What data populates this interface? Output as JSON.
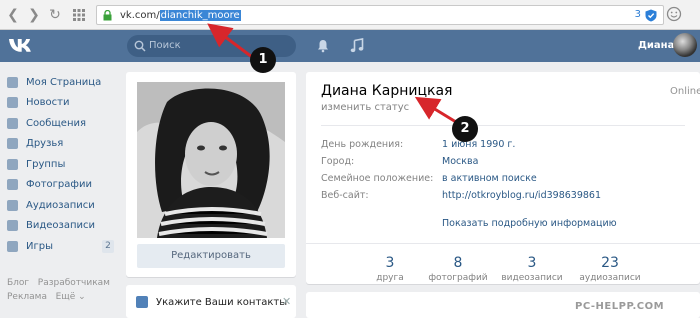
{
  "browser": {
    "url_prefix": "vk.com/",
    "url_selected": "dianchik_moore",
    "extensions_count": "3"
  },
  "header": {
    "search_placeholder": "Поиск",
    "user_name": "Диана"
  },
  "sidebar": {
    "items": [
      {
        "label": "Моя Страница",
        "icon": "home-icon"
      },
      {
        "label": "Новости",
        "icon": "news-icon"
      },
      {
        "label": "Сообщения",
        "icon": "messages-icon"
      },
      {
        "label": "Друзья",
        "icon": "friends-icon"
      },
      {
        "label": "Группы",
        "icon": "groups-icon"
      },
      {
        "label": "Фотографии",
        "icon": "photos-icon"
      },
      {
        "label": "Аудиозаписи",
        "icon": "audio-icon"
      },
      {
        "label": "Видеозаписи",
        "icon": "video-icon"
      },
      {
        "label": "Игры",
        "icon": "games-icon",
        "badge": "2"
      }
    ],
    "footer": {
      "blog": "Блог",
      "developers": "Разработчикам",
      "ads": "Реклама",
      "more": "Ещё ⌄"
    }
  },
  "photo_card": {
    "edit_label": "Редактировать"
  },
  "contacts_card": {
    "text": "Укажите Ваши контакты",
    "close": "✕"
  },
  "profile": {
    "name": "Диана Карницкая",
    "status_hint": "изменить статус",
    "online": "Online",
    "info": [
      {
        "label": "День рождения:",
        "value": "1 июня 1990 г."
      },
      {
        "label": "Город:",
        "value": "Москва"
      },
      {
        "label": "Семейное положение:",
        "value": "в активном поиске"
      },
      {
        "label": "Веб-сайт:",
        "value": "http://otkroyblog.ru/id398639861"
      }
    ],
    "more_info": "Показать подробную информацию",
    "stats": [
      {
        "num": "3",
        "label": "друга"
      },
      {
        "num": "8",
        "label": "фотографий"
      },
      {
        "num": "3",
        "label": "видеозаписи"
      },
      {
        "num": "23",
        "label": "аудиозаписи"
      }
    ]
  },
  "annotations": {
    "marker1": "1",
    "marker2": "2",
    "arrow_color": "#d7262b"
  },
  "watermark": "PC-HELPP.COM"
}
